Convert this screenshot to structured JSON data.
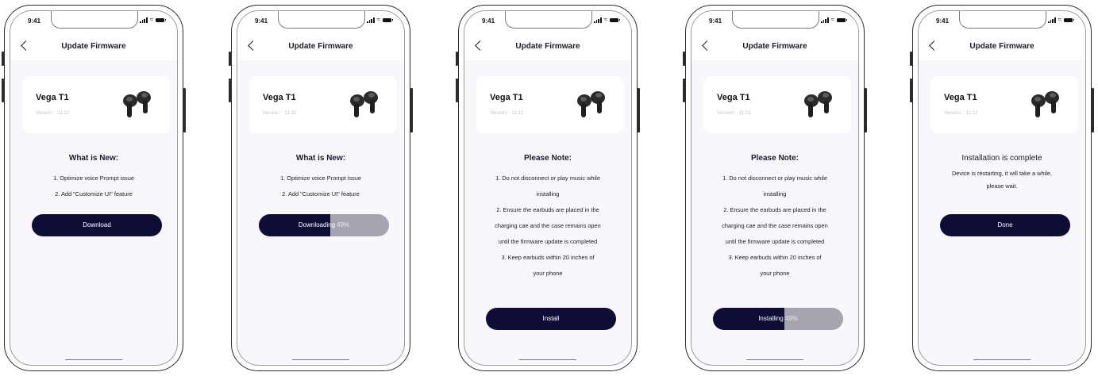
{
  "statusbar": {
    "time": "9:41"
  },
  "header": {
    "title": "Update Firmware"
  },
  "device": {
    "name": "Vega T1",
    "version": "Version： 11.12"
  },
  "whats_new": {
    "title": "What is New:",
    "lines": [
      "1. Optimize voice Prompt issue",
      "2. Add \"Customize UI\" feature"
    ]
  },
  "please_note": {
    "title": "Please Note:",
    "lines": [
      "1. Do not disconnect or play music while",
      "installing",
      "2. Ensure the earbuds are placed in the",
      "charging cae and the case remains open",
      "until the firmware update is completed",
      "3. Keep earbuds within 20 inches of",
      "your phone"
    ]
  },
  "complete": {
    "title": "Installation is complete",
    "lines": [
      "Device is restarting, it will take a while,",
      "please wait."
    ]
  },
  "buttons": {
    "download": "Download",
    "downloading": "Downloading",
    "download_progress": "49%",
    "download_progress_value": 0.55,
    "install": "Install",
    "installing": "Installing",
    "install_progress": "49%",
    "install_progress_value": 0.55,
    "done": "Done"
  },
  "colors": {
    "button": "#0d0d36",
    "progress_track": "#a5a5b0",
    "background": "#f9f6fc"
  }
}
